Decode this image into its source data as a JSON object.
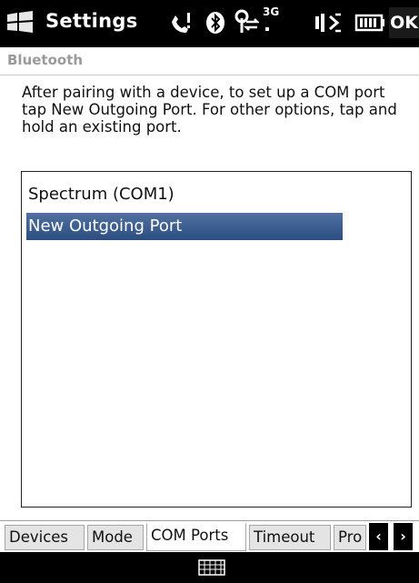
{
  "titlebar": {
    "title": "Settings",
    "ok_label": "OK",
    "network_label": "3G"
  },
  "subheader": {
    "label": "Bluetooth"
  },
  "instructions": "After pairing with a device, to set up a COM port tap New Outgoing Port. For other options, tap and hold an existing port.",
  "ports": [
    {
      "label": "Spectrum (COM1)",
      "selected": false
    },
    {
      "label": "New Outgoing Port",
      "selected": true
    }
  ],
  "tabs": [
    {
      "label": "Devices",
      "active": false
    },
    {
      "label": "Mode",
      "active": false
    },
    {
      "label": "COM Ports",
      "active": true
    },
    {
      "label": "Timeout",
      "active": false
    },
    {
      "label": "Pro",
      "active": false
    }
  ],
  "icons": {
    "title_logo": "windows-logo-icon",
    "status": [
      "phone-call-icon",
      "bluetooth-icon",
      "signal-icon",
      "network-3g-icon",
      "volume-icon",
      "battery-icon"
    ],
    "bottom": "keyboard-icon"
  },
  "colors": {
    "selection": "#3b5f93",
    "titlebar": "#000000",
    "subheader_text": "#9a9a9a"
  }
}
